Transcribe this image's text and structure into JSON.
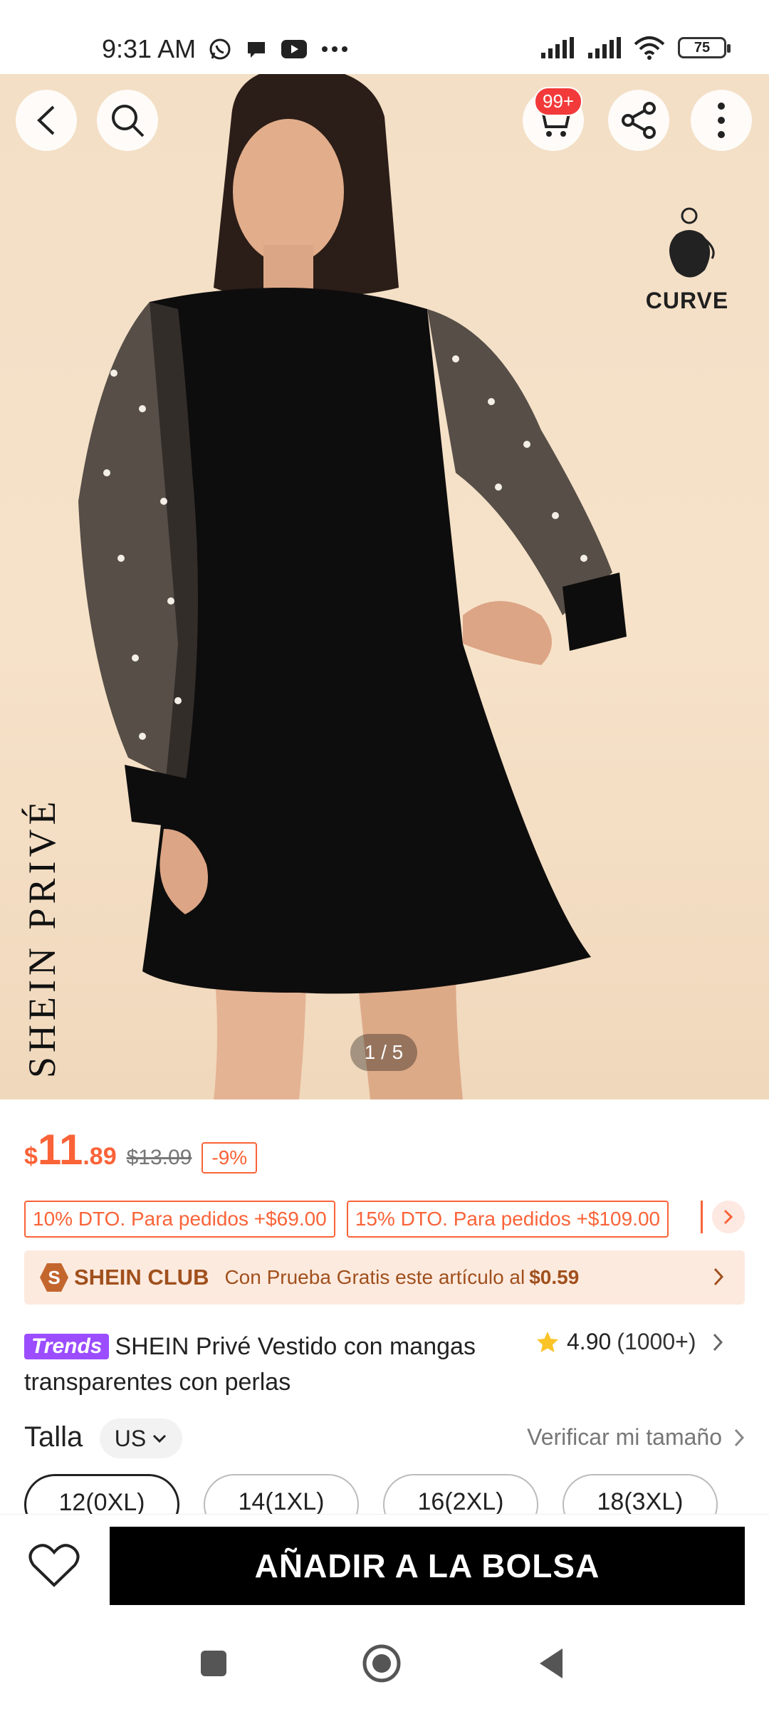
{
  "status_bar": {
    "time": "9:31 AM",
    "battery": "75",
    "app_icons": [
      "whatsapp-icon",
      "chat-bubble-icon",
      "youtube-icon",
      "more-dots-icon"
    ],
    "right_icons": [
      "signal-icon",
      "signal-icon",
      "wifi-icon",
      "battery-icon"
    ]
  },
  "hero": {
    "cart_badge": "99+",
    "brand_vertical": "SHEIN PRIVÉ",
    "curve_label": "CURVE",
    "pager": "1 / 5"
  },
  "price": {
    "currency": "$",
    "integer": "11",
    "decimal": ".89",
    "original": "$13.09",
    "discount": "-9%"
  },
  "coupons": [
    {
      "label": "10% DTO. Para pedidos +$69.00"
    },
    {
      "label": "15% DTO. Para pedidos +$109.00"
    }
  ],
  "club": {
    "badge": "S",
    "name": "SHEIN CLUB",
    "desc": "Con Prueba Gratis este artículo al",
    "price": "$0.59"
  },
  "product": {
    "badge": "Trends",
    "title": "SHEIN Privé Vestido con mangas transparentes con perlas",
    "rating": "4.90",
    "review_count": "(1000+)"
  },
  "size": {
    "label": "Talla",
    "unit": "US",
    "check_link": "Verificar mi tamaño",
    "options": [
      {
        "label": "12(0XL)",
        "selected": true
      },
      {
        "label": "14(1XL)",
        "selected": false
      },
      {
        "label": "16(2XL)",
        "selected": false
      },
      {
        "label": "18(3XL)",
        "selected": false
      }
    ]
  },
  "actions": {
    "add_to_bag": "AÑADIR A LA BOLSA"
  },
  "colors": {
    "accent": "#fa6338",
    "club": "#a0501d",
    "trends": "#9b4dff",
    "badge_red": "#f23a3a"
  }
}
